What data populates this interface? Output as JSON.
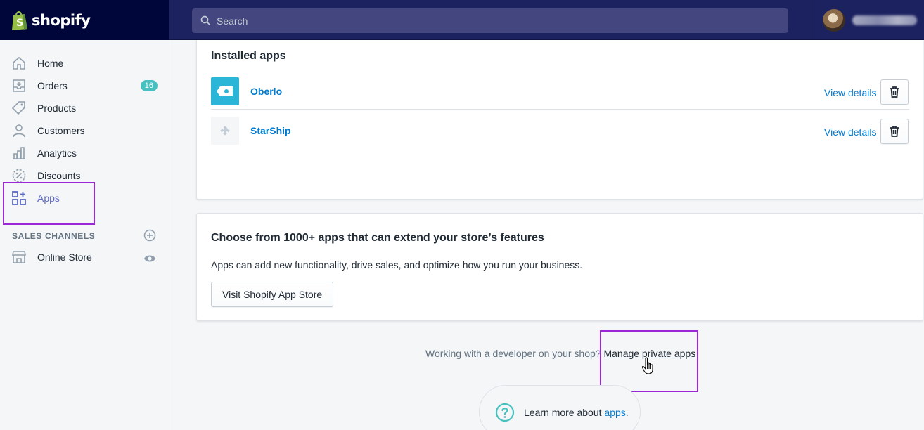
{
  "topbar": {
    "brand": "shopify",
    "search_placeholder": "Search"
  },
  "sidebar": {
    "items": [
      {
        "label": "Home",
        "icon": "home-icon"
      },
      {
        "label": "Orders",
        "icon": "orders-icon",
        "badge": "16"
      },
      {
        "label": "Products",
        "icon": "tag-icon"
      },
      {
        "label": "Customers",
        "icon": "person-icon"
      },
      {
        "label": "Analytics",
        "icon": "bar-chart-icon"
      },
      {
        "label": "Discounts",
        "icon": "discount-icon"
      },
      {
        "label": "Apps",
        "icon": "apps-icon",
        "active": true
      }
    ],
    "sales_channels_label": "SALES CHANNELS",
    "channels": [
      {
        "label": "Online Store",
        "icon": "store-icon"
      }
    ]
  },
  "installed_apps": {
    "title": "Installed apps",
    "apps": [
      {
        "name": "Oberlo",
        "action": "View details",
        "logo_color": "#2bb5d6"
      },
      {
        "name": "StarShip",
        "action": "View details",
        "logo_color": "#f4f6f8"
      }
    ]
  },
  "app_store": {
    "title": "Choose from 1000+ apps that can extend your store’s features",
    "description": "Apps can add new functionality, drive sales, and optimize how you run your business.",
    "button": "Visit Shopify App Store"
  },
  "developer": {
    "text": "Working with a developer on your shop?",
    "link": "Manage private apps"
  },
  "learn_more": {
    "text": "Learn more about",
    "link": "apps",
    "suffix": "."
  },
  "colors": {
    "brand_bg": "#000639",
    "topbar_bg": "#1c2260",
    "accent": "#5c6ac4",
    "link": "#007ace",
    "badge": "#47c1bf",
    "highlight": "#9c27d6"
  }
}
